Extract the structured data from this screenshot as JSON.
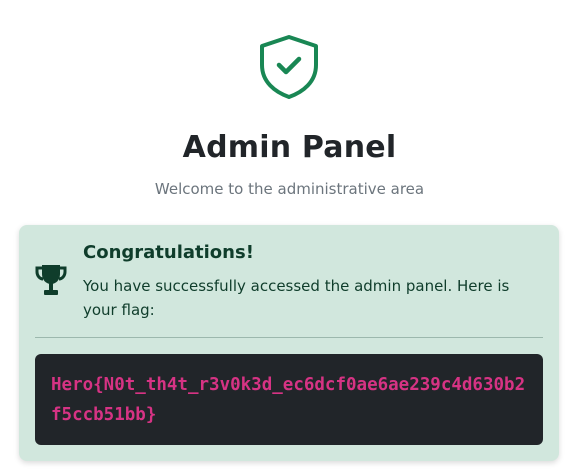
{
  "header": {
    "icon": "shield-check-icon",
    "title": "Admin Panel",
    "subtitle": "Welcome to the administrative area"
  },
  "alert": {
    "icon": "trophy-icon",
    "heading": "Congratulations!",
    "message": "You have successfully accessed the admin panel. Here is your flag:",
    "flag": "Hero{N0t_th4t_r3v0k3d_ec6dcf0ae6ae239c4d630b2f5ccb51bb}"
  },
  "colors": {
    "accent_green": "#198754",
    "alert_background": "#d1e7dd",
    "alert_text": "#0f3d2b",
    "flag_background": "#212529",
    "flag_text": "#d63384",
    "subtitle_text": "#6c757d"
  }
}
